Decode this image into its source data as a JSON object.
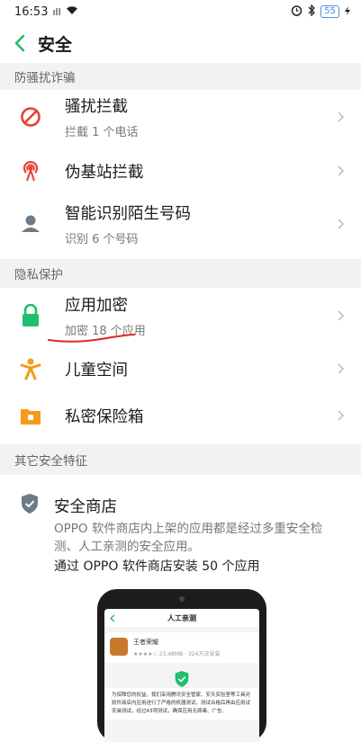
{
  "status_bar": {
    "time": "16:53",
    "signal_text": "ıll",
    "battery": "55"
  },
  "header": {
    "title": "安全"
  },
  "sections": {
    "fraud": {
      "label": "防骚扰诈骗",
      "items": [
        {
          "title": "骚扰拦截",
          "sub": "拦截 1 个电话",
          "icon": "no-entry-icon"
        },
        {
          "title": "伪基站拦截",
          "sub": "",
          "icon": "signal-tower-icon"
        },
        {
          "title": "智能识别陌生号码",
          "sub": "识别 6 个号码",
          "icon": "person-icon"
        }
      ]
    },
    "privacy": {
      "label": "隐私保护",
      "items": [
        {
          "title": "应用加密",
          "sub": "加密 18 个应用",
          "icon": "lock-icon"
        },
        {
          "title": "儿童空间",
          "sub": "",
          "icon": "child-icon"
        },
        {
          "title": "私密保险箱",
          "sub": "",
          "icon": "safe-folder-icon"
        }
      ]
    },
    "other": {
      "label": "其它安全特征"
    }
  },
  "store": {
    "title": "安全商店",
    "desc": "OPPO 软件商店内上架的应用都是经过多重安全检测、人工亲测的安全应用。",
    "install": "通过 OPPO 软件商店安装 50 个应用"
  },
  "phone_mock": {
    "title": "人工亲测",
    "app_name": "王者荣耀",
    "app_meta": "★★★★☆ 23.48MB · 324万次安装",
    "text": "为保障您的权益，我们采用腾讯安全管家、安天实验室等工具对软件商店内应用进行了严格的机器测试，测试合格后再由应用试安装测试，经过43项测试，确保应用无病毒、广告、"
  },
  "colors": {
    "accent_green": "#1fbf6b",
    "annotation_red": "#e0252b"
  }
}
